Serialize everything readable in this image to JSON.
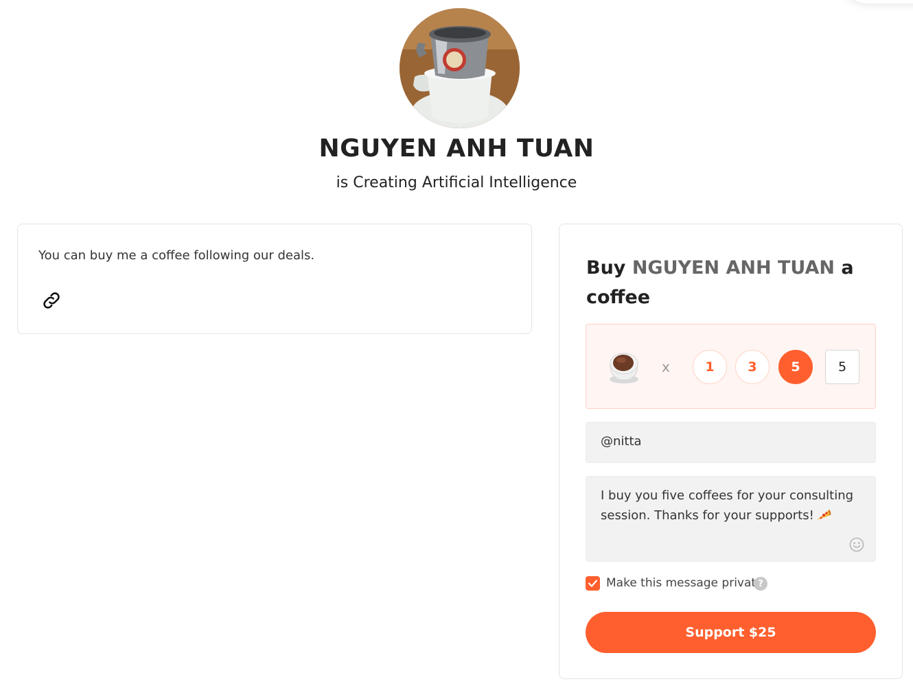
{
  "creator": {
    "name": "NGUYEN ANH TUAN",
    "tagline": "is Creating Artificial Intelligence"
  },
  "about": {
    "text": "You can buy me a coffee following our deals."
  },
  "support": {
    "title_prefix": "Buy ",
    "title_name": "NGUYEN ANH TUAN",
    "title_suffix": " a coffee",
    "multiplier": "x",
    "quantity_options": [
      "1",
      "3",
      "5"
    ],
    "selected_quantity": "5",
    "quantity_value": "5",
    "name_value": "@nitta",
    "message_value": "I buy you five coffees for your consulting session. Thanks for your supports!",
    "private_label": "Make this message private",
    "private_checked": true,
    "help_symbol": "?",
    "button_label": "Support $25"
  },
  "colors": {
    "accent": "#ff5f2e",
    "picker_bg": "#fff5f2",
    "field_bg": "#f2f2f2",
    "name_highlight": "#666666"
  },
  "icons": [
    "coffee-avatar-image",
    "link-icon",
    "coffee-cup-icon",
    "pizza-emoji-icon",
    "smile-icon",
    "check-icon",
    "help-icon"
  ]
}
